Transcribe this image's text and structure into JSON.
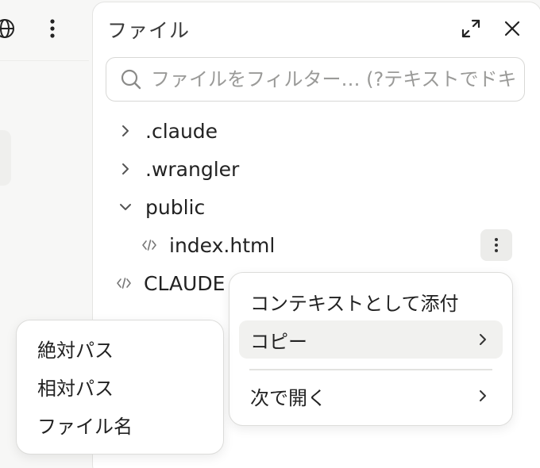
{
  "left_toolbar": {
    "globe_icon": "globe-icon",
    "more_icon": "vertical-dots-icon"
  },
  "files_panel": {
    "title": "ファイル",
    "expand_icon": "expand-arrows-icon",
    "close_icon": "close-icon",
    "filter": {
      "placeholder": "ファイルをフィルター… (?テキストでドキュメントを検索)",
      "value": "",
      "icon": "search-icon"
    },
    "tree": [
      {
        "label": ".claude",
        "type": "folder",
        "expanded": false,
        "depth": 0
      },
      {
        "label": ".wrangler",
        "type": "folder",
        "expanded": false,
        "depth": 0
      },
      {
        "label": "public",
        "type": "folder",
        "expanded": true,
        "depth": 0
      },
      {
        "label": "index.html",
        "type": "file",
        "depth": 1,
        "selected": true
      },
      {
        "label": "CLAUDE",
        "type": "file",
        "depth": 0
      }
    ],
    "row_more_icon": "vertical-dots-icon"
  },
  "context_menu": {
    "items": [
      {
        "label": "コンテキストとして添付",
        "has_submenu": false
      },
      {
        "label": "コピー",
        "has_submenu": true,
        "highlighted": true
      },
      {
        "label": "次で開く",
        "has_submenu": true
      }
    ]
  },
  "copy_submenu": {
    "items": [
      {
        "label": "絶対パス"
      },
      {
        "label": "相対パス"
      },
      {
        "label": "ファイル名"
      }
    ]
  },
  "colors": {
    "background": "#f7f7f6",
    "panel": "#ffffff",
    "highlight": "#f1f1ef",
    "text": "#222222",
    "muted": "#9a9a98"
  }
}
